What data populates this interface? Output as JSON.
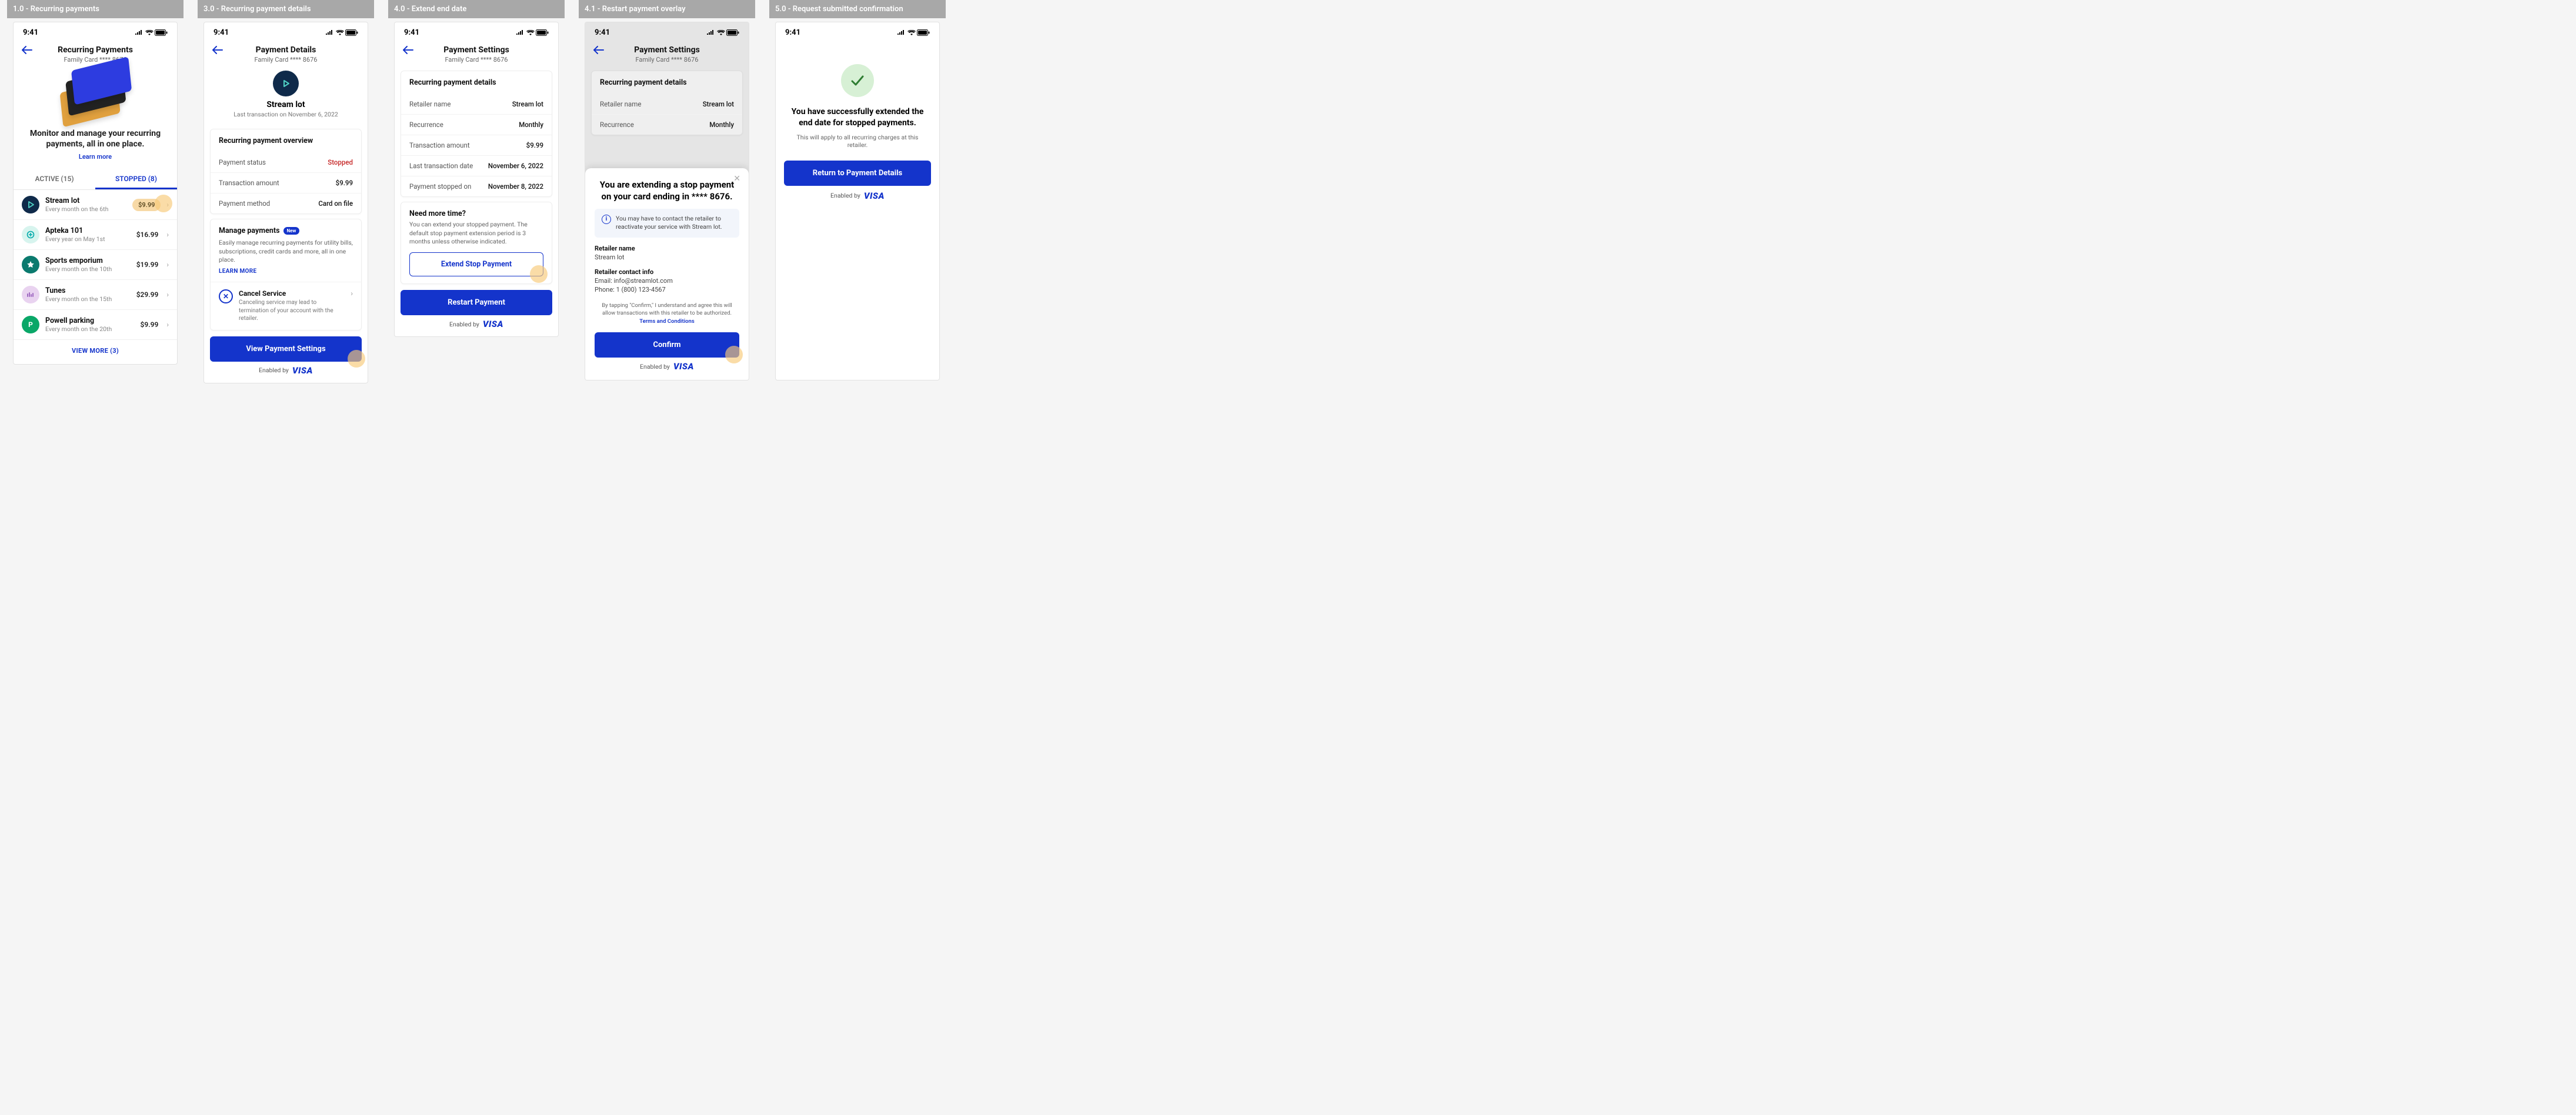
{
  "status_time": "9:41",
  "card_sub_label": "Family Card   **** 8676",
  "enabled_by_label": "Enabled by",
  "visa_mark": "VISA",
  "panels": {
    "p1": {
      "title": "1.0 - Recurring payments"
    },
    "p3": {
      "title": "3.0 - Recurring payment details"
    },
    "p4": {
      "title": "4.0 - Extend end date"
    },
    "p41": {
      "title": "4.1 - Restart payment overlay"
    },
    "p5": {
      "title": "5.0 - Request submitted confirmation"
    }
  },
  "screen1": {
    "nav_title": "Recurring Payments",
    "hero_line": "Monitor and manage your recurring payments, all in one place.",
    "learn_more": "Learn more",
    "tab_active": "ACTIVE (15)",
    "tab_stopped": "STOPPED (8)",
    "items": [
      {
        "name": "Stream lot",
        "sub": "Every month on the 6th",
        "price": "$9.99",
        "icon_bg": "#0f2a4a",
        "icon_type": "play",
        "highlight": true
      },
      {
        "name": "Apteka 101",
        "sub": "Every year on May 1st",
        "price": "$16.99",
        "icon_bg": "#d7f4ee",
        "icon_type": "plus",
        "icon_fg": "#0aa"
      },
      {
        "name": "Sports emporium",
        "sub": "Every month on the 10th",
        "price": "$19.99",
        "icon_bg": "#0b7a6e",
        "icon_type": "star"
      },
      {
        "name": "Tunes",
        "sub": "Every month on the 15th",
        "price": "$29.99",
        "icon_bg": "#e9d3f0",
        "icon_type": "bars",
        "icon_fg": "#a06ac2"
      },
      {
        "name": "Powell parking",
        "sub": "Every month on the 20th",
        "price": "$9.99",
        "icon_bg": "#0aa768",
        "icon_type": "letter",
        "letter": "P"
      }
    ],
    "view_more": "VIEW MORE (3)"
  },
  "screen3": {
    "nav_title": "Payment Details",
    "merchant": "Stream lot",
    "merchant_sub": "Last transaction on November 6, 2022",
    "overview_title": "Recurring payment overview",
    "kv": [
      {
        "k": "Payment status",
        "v": "Stopped",
        "stopped": true
      },
      {
        "k": "Transaction amount",
        "v": "$9.99"
      },
      {
        "k": "Payment method",
        "v": "Card on file"
      }
    ],
    "mp_title": "Manage payments",
    "mp_new": "New",
    "mp_desc": "Easily manage recurring payments for utility bills, subscriptions, credit cards and more, all in one place.",
    "mp_learn": "LEARN MORE",
    "cancel_title": "Cancel Service",
    "cancel_sub": "Canceling service may lead to termination of your account with the retailer.",
    "primary": "View Payment Settings"
  },
  "screen4": {
    "nav_title": "Payment Settings",
    "details_title": "Recurring payment details",
    "kv": [
      {
        "k": "Retailer name",
        "v": "Stream lot"
      },
      {
        "k": "Recurrence",
        "v": "Monthly"
      },
      {
        "k": "Transaction amount",
        "v": "$9.99"
      },
      {
        "k": "Last transaction date",
        "v": "November 6, 2022"
      },
      {
        "k": "Payment stopped on",
        "v": "November 8, 2022"
      }
    ],
    "need_title": "Need more time?",
    "need_desc": "You can extend your stopped payment. The default stop payment extension period is 3 months unless otherwise indicated.",
    "extend_btn": "Extend Stop Payment",
    "restart_btn": "Restart Payment"
  },
  "screen41": {
    "nav_title": "Payment Settings",
    "details_title": "Recurring payment details",
    "kv": [
      {
        "k": "Retailer name",
        "v": "Stream lot"
      },
      {
        "k": "Recurrence",
        "v": "Monthly"
      }
    ],
    "sheet_title": "You are extending a stop payment on your card ending in **** 8676.",
    "info": "You may have to contact the retailer to reactivate your service with Stream lot.",
    "retailer_label": "Retailer name",
    "retailer_value": "Stream lot",
    "contact_label": "Retailer contact info",
    "contact_email": "Email: info@streamlot.com",
    "contact_phone": "Phone: 1 (800) 123-4567",
    "consent": "By tapping \"Confirm,\" I understand and agree this will allow transactions with this retailer to be authorized.",
    "tnc": "Terms and Conditions",
    "confirm_btn": "Confirm"
  },
  "screen5": {
    "success_title": "You have successfully extended the end date for stopped payments.",
    "success_sub": "This will apply to all recurring charges at this retailer.",
    "return_btn": "Return to Payment Details"
  }
}
